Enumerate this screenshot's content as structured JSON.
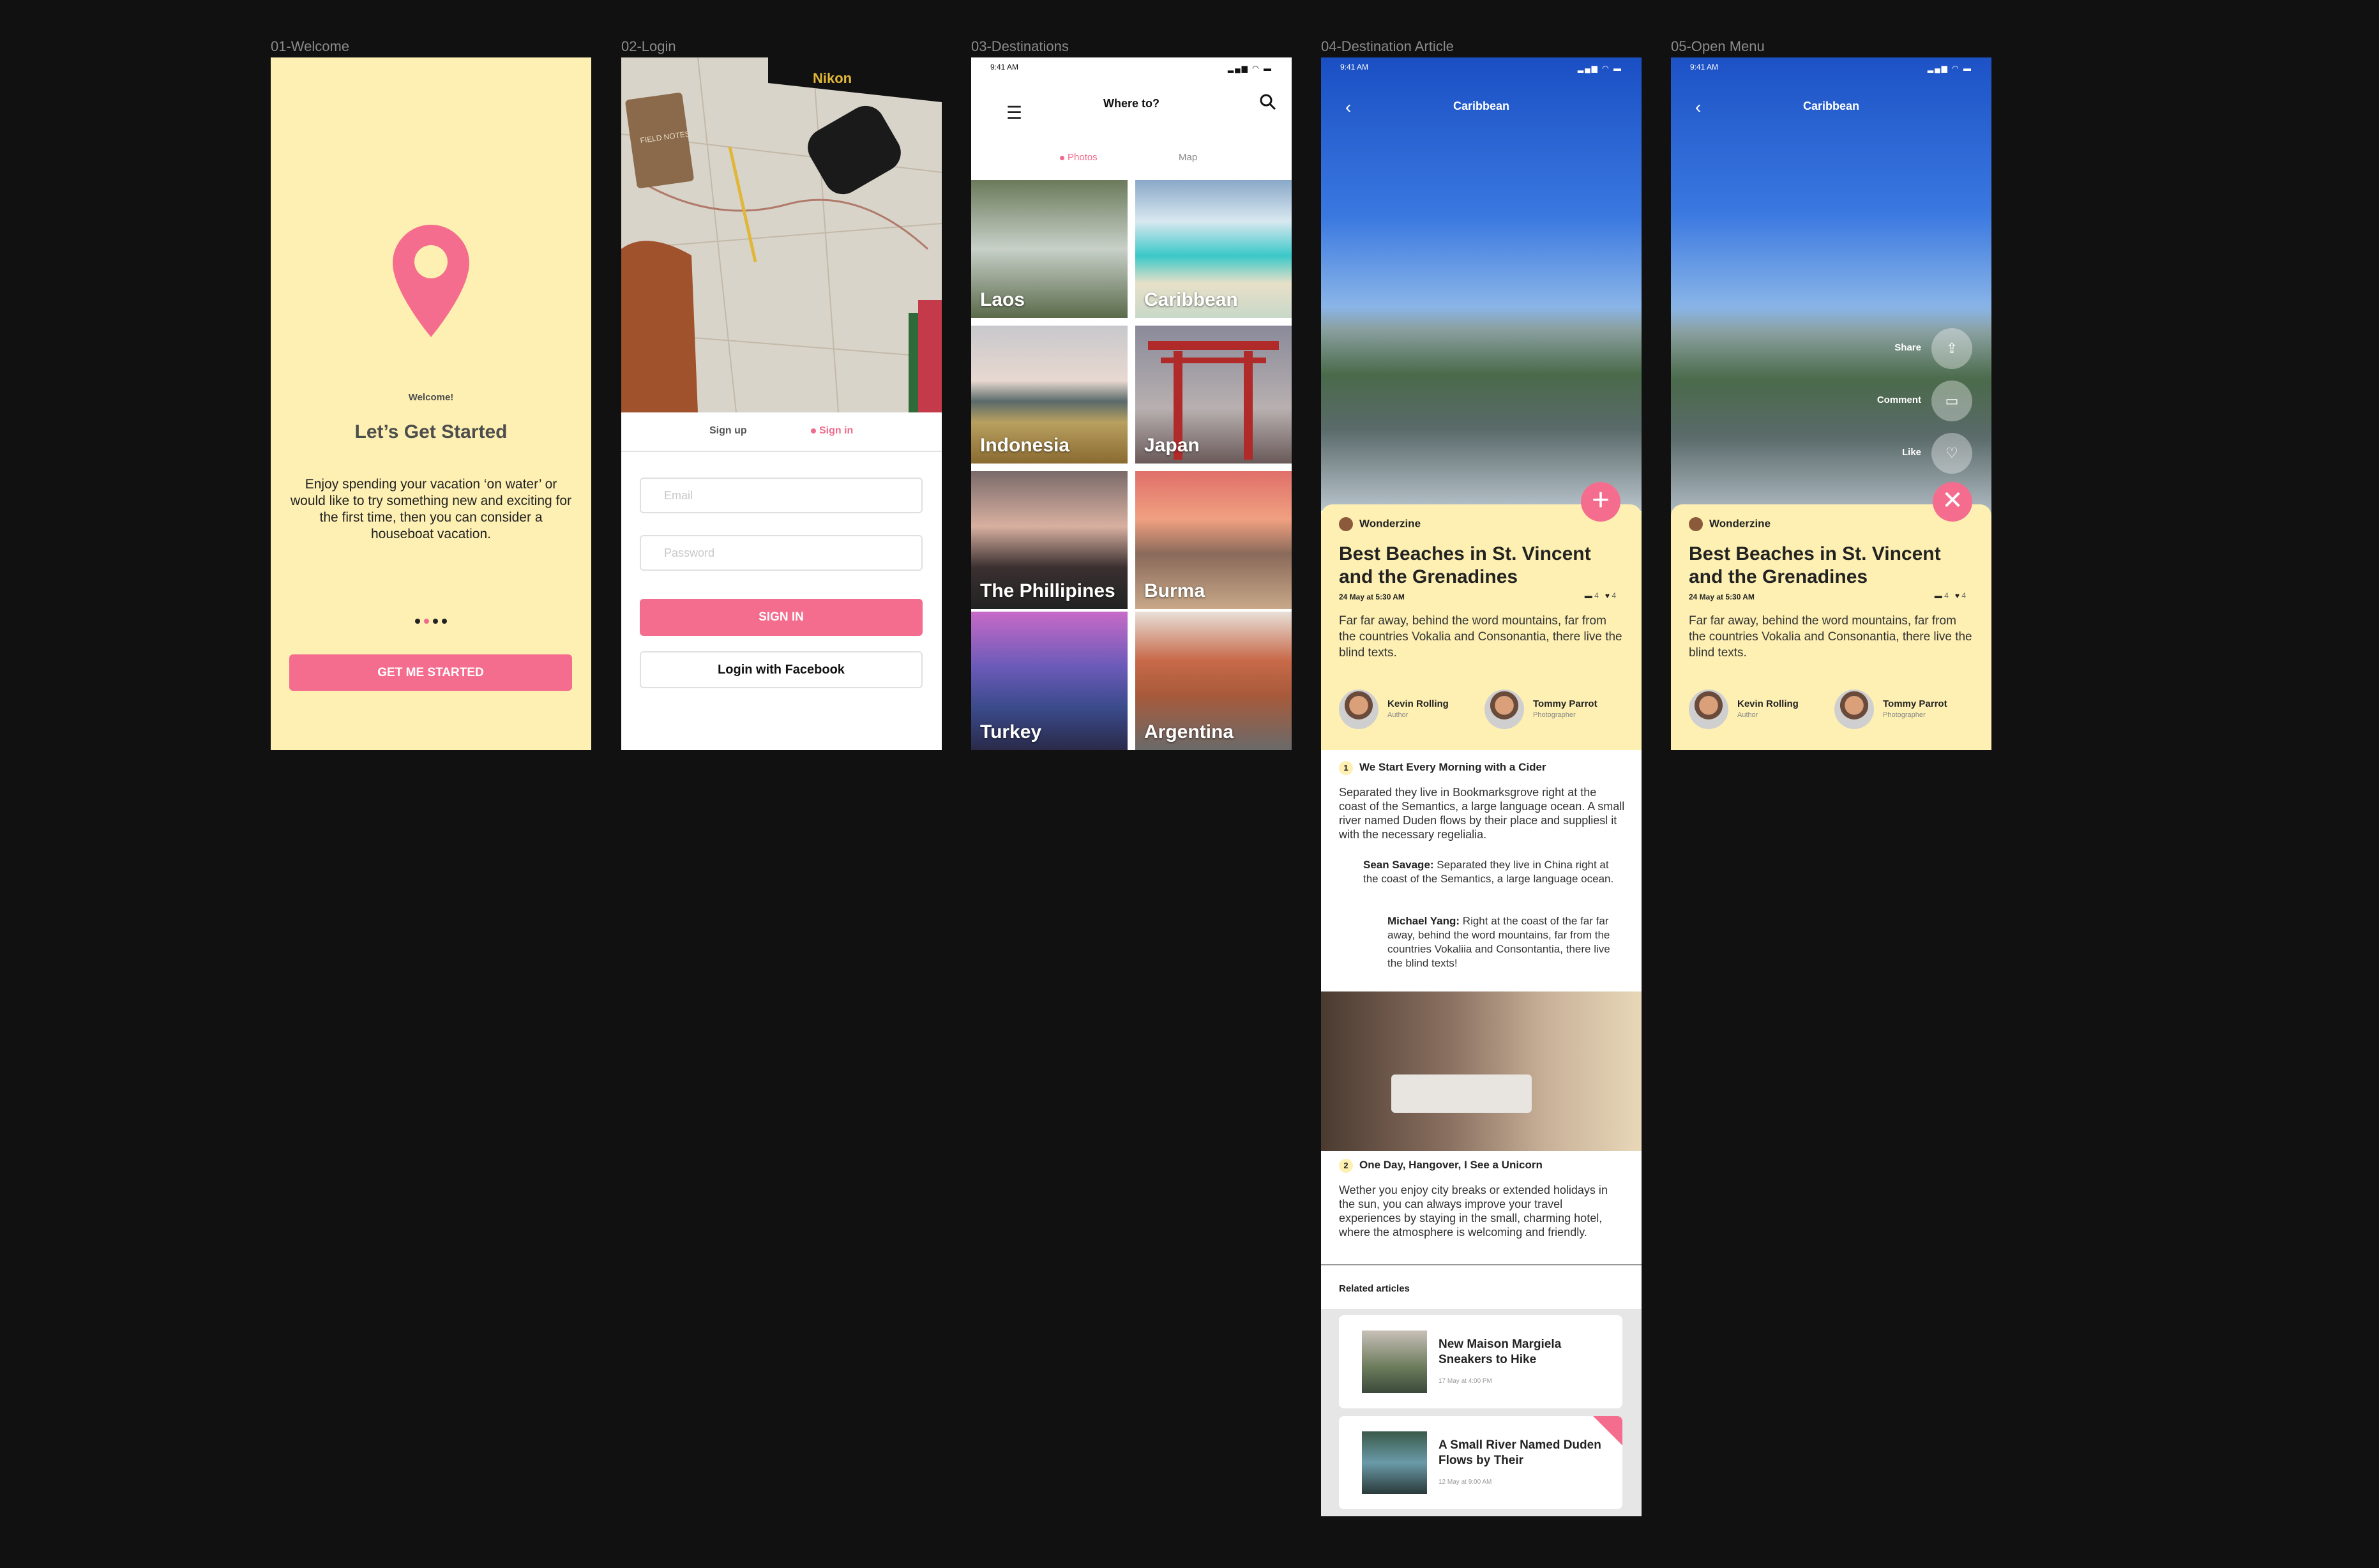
{
  "labels": [
    "01-Welcome",
    "02-Login",
    "03-Destinations",
    "04-Destination Article",
    "05-Open Menu"
  ],
  "status": {
    "time": "9:41 AM",
    "signal": "▂▄▆ ◠ ▬"
  },
  "welcome": {
    "kicker": "Welcome!",
    "title": "Let’s Get Started",
    "body": "Enjoy spending your vacation ‘on water’ or would like to try something new and exciting for the first time, then you can consider a houseboat vacation.",
    "button": "GET ME STARTED"
  },
  "login": {
    "tab_signup": "Sign up",
    "tab_signin": "Sign in",
    "email_placeholder": "Email",
    "password_placeholder": "Password",
    "signin_button": "SIGN IN",
    "facebook_button": "Login with Facebook"
  },
  "destinations": {
    "title": "Where to?",
    "tab_photos": "Photos",
    "tab_map": "Map",
    "tiles": [
      "Laos",
      "Caribbean",
      "Indonesia",
      "Japan",
      "The Phillipines",
      "Burma",
      "Turkey",
      "Argentina"
    ]
  },
  "article": {
    "header": "Caribbean",
    "publisher": "Wonderzine",
    "title": "Best Beaches in St. Vincent and the Grenadines",
    "date": "24 May at 5:30 AM",
    "comments": "4",
    "likes": "4",
    "intro": "Far far away, behind the word mountains, far from the countries Vokalia and Consonantia, there live the blind texts.",
    "author_name": "Kevin Rolling",
    "author_role": "Author",
    "photographer_name": "Tommy Parrot",
    "photographer_role": "Photographer",
    "s1_num": "1",
    "s1_title": "We Start Every Morning with a Cider",
    "s1_body": "Separated they live in Bookmarksgrove right at the coast of the Semantics, a large language ocean.  A small river named Duden flows by their place and suppliesl it with the necessary regelialia.",
    "q1_name": "Sean Savage:",
    "q1_text": " Separated they live in China right at the coast of the Semantics, a large language ocean.",
    "q2_name": "Michael Yang:",
    "q2_text": " Right at the coast of the far far away, behind the word mountains, far from the countries Vokaliia and Consontantia, there live the blind texts!",
    "s2_num": "2",
    "s2_title": "One Day, Hangover, I See a Unicorn",
    "s2_body": "Wether you enjoy city breaks or extended holidays in the sun, you can always improve your travel experiences by staying in the small, charming hotel, where the atmosphere is welcoming and friendly.",
    "related_title": "Related articles",
    "related": [
      {
        "title": "New Maison Margiela Sneakers to Hike",
        "date": "17 May at 4:00 PM"
      },
      {
        "title": "A Small River Named Duden Flows by Their",
        "date": "12 May at 9:00 AM"
      }
    ]
  },
  "menu": {
    "share": "Share",
    "comment": "Comment",
    "like": "Like"
  },
  "colors": {
    "pink": "#f56d8e",
    "cream": "#fdf0b2",
    "background": "#111111"
  }
}
